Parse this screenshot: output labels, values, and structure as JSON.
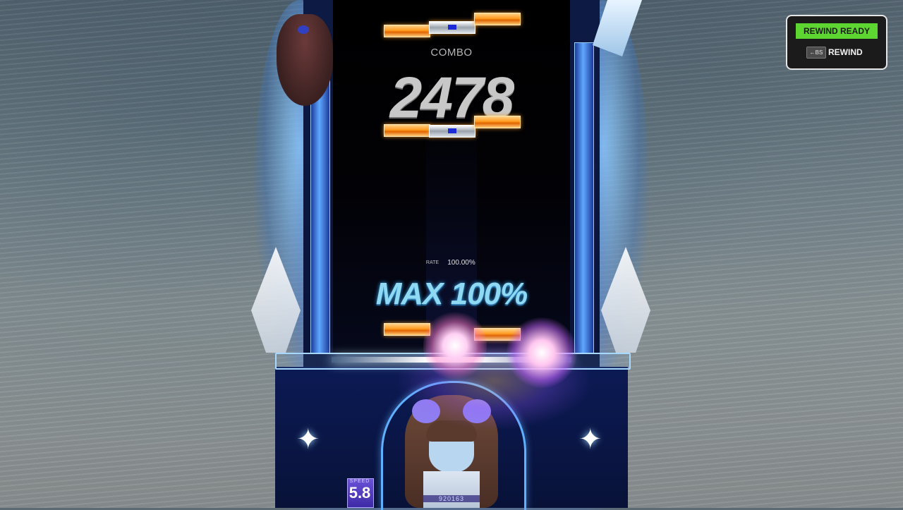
{
  "hud": {
    "combo_label": "COMBO",
    "combo_value": "2478",
    "rate_label": "RATE",
    "rate_value": "100.00%",
    "max_text": "MAX 100%",
    "speed_label": "SPEED",
    "speed_value": "5.8",
    "score_value": "920163"
  },
  "rewind": {
    "ready_label": "REWIND READY",
    "key_label": "←BS",
    "action_label": "REWIND"
  },
  "colors": {
    "ready_green": "#5dd632",
    "note_orange": "#ff9a1e",
    "max_text_blue": "#8fd9f3",
    "frame_blue": "#1b3a9a"
  },
  "icons": {
    "star": "✦"
  }
}
